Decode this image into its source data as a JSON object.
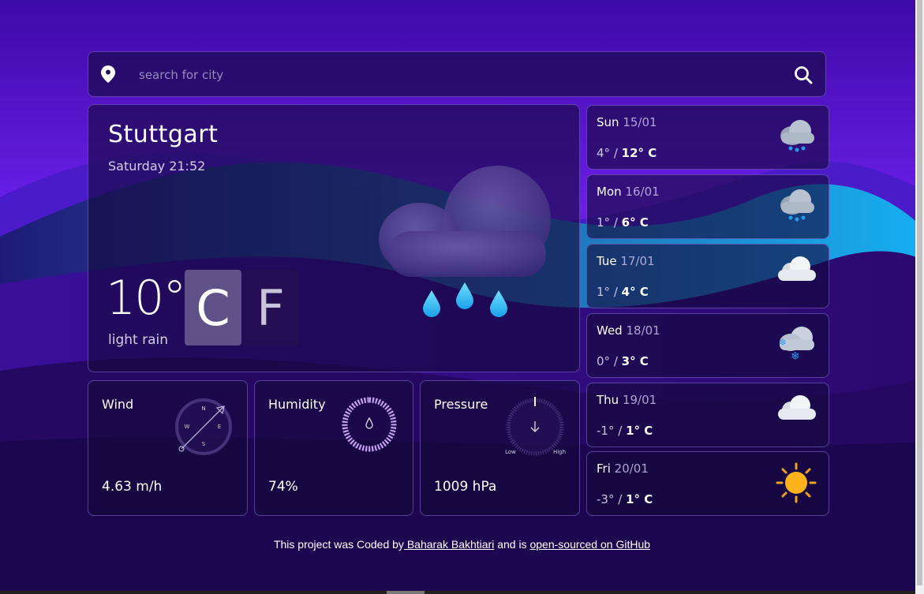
{
  "search": {
    "placeholder": "search for city"
  },
  "current": {
    "city": "Stuttgart",
    "datetime": "Saturday 21:52",
    "temperature": "10°",
    "description": "light rain",
    "unit_c": "C",
    "unit_f": "F",
    "icon": "rain-cloud-icon"
  },
  "wind": {
    "title": "Wind",
    "value": "4.63 m/h",
    "compass": [
      "N",
      "E",
      "S",
      "W"
    ]
  },
  "humidity": {
    "title": "Humidity",
    "value": "74%",
    "percent": 74
  },
  "pressure": {
    "title": "Pressure",
    "value": "1009 hPa",
    "low_label": "Low",
    "high_label": "High"
  },
  "forecast": [
    {
      "day": "Sun",
      "date": "15/01",
      "min": "4°",
      "max": "12° C",
      "icon": "rain-cloud-icon"
    },
    {
      "day": "Mon",
      "date": "16/01",
      "min": "1°",
      "max": "6° C",
      "icon": "rain-cloud-icon"
    },
    {
      "day": "Tue",
      "date": "17/01",
      "min": "1°",
      "max": "4° C",
      "icon": "cloud-icon"
    },
    {
      "day": "Wed",
      "date": "18/01",
      "min": "0°",
      "max": "3° C",
      "icon": "snow-cloud-icon"
    },
    {
      "day": "Thu",
      "date": "19/01",
      "min": "-1°",
      "max": "1° C",
      "icon": "cloud-icon"
    },
    {
      "day": "Fri",
      "date": "20/01",
      "min": "-3°",
      "max": "1° C",
      "icon": "sun-icon"
    }
  ],
  "footer": {
    "prefix": "This project was Coded by",
    "author": " Baharak Bakhtiari",
    "middle": " and is ",
    "github": "open-sourced on GitHub"
  },
  "colors": {
    "accent": "#7a3cff",
    "background": "#2a0a6e",
    "wave_cyan": "#18b4f0"
  }
}
